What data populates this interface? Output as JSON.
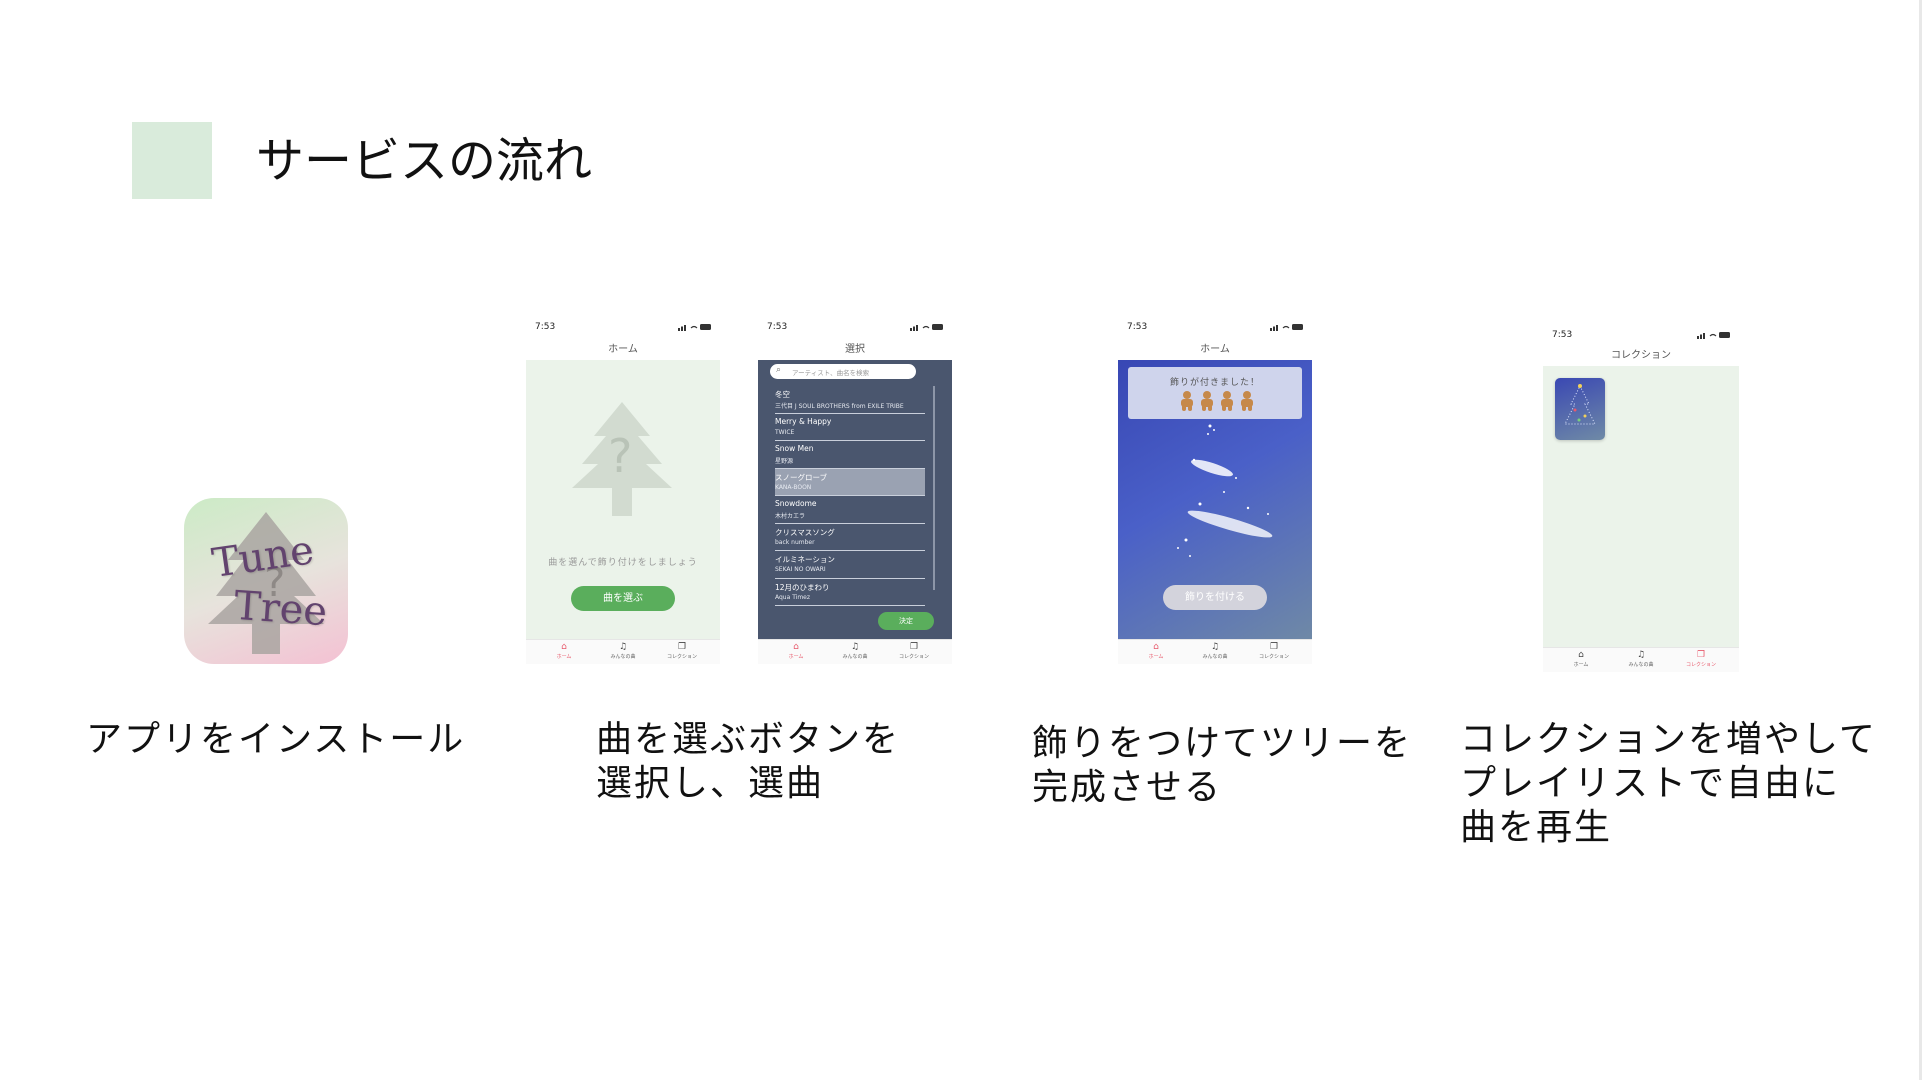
{
  "slide": {
    "title": "サービスの流れ",
    "accent_color": "#d9ebdb"
  },
  "steps": [
    {
      "caption": [
        "アプリをインストール"
      ]
    },
    {
      "caption": [
        "曲を選ぶボタンを",
        "選択し、選曲"
      ]
    },
    {
      "caption": [
        "飾りをつけてツリーを",
        "完成させる"
      ]
    },
    {
      "caption": [
        "コレクションを増やして",
        "プレイリストで自由に",
        "曲を再生"
      ]
    }
  ],
  "app_icon": {
    "line1": "Tune",
    "line2": "Tree",
    "tree_icon": "tree-icon"
  },
  "tabbar": {
    "home": "ホーム",
    "everyone": "みんなの曲",
    "collection": "コレクション"
  },
  "screen_home": {
    "time": "7:53",
    "nav_title": "ホーム",
    "prompt": "曲を選んで飾り付けをしましょう",
    "button": "曲を選ぶ",
    "background": "#ebf3ea",
    "button_color": "#5aae5c"
  },
  "screen_select": {
    "time": "7:53",
    "nav_title": "選択",
    "search_placeholder": "アーティスト、曲名を検索",
    "songs": [
      {
        "title": "冬空",
        "artist": "三代目 J SOUL BROTHERS from EXILE TRIBE",
        "selected": false
      },
      {
        "title": "Merry & Happy",
        "artist": "TWICE",
        "selected": false
      },
      {
        "title": "Snow Men",
        "artist": "星野源",
        "selected": false
      },
      {
        "title": "スノーグローブ",
        "artist": "KANA-BOON",
        "selected": true
      },
      {
        "title": "Snowdome",
        "artist": "木村カエラ",
        "selected": false
      },
      {
        "title": "クリスマスソング",
        "artist": "back number",
        "selected": false
      },
      {
        "title": "イルミネーション",
        "artist": "SEKAI NO OWARI",
        "selected": false
      },
      {
        "title": "12月のひまわり",
        "artist": "Aqua Timez",
        "selected": false
      }
    ],
    "confirm": "決定",
    "background": "#4a566e"
  },
  "screen_tree": {
    "time": "7:53",
    "nav_title": "ホーム",
    "banner": "飾りが付きました！",
    "ornament_count": 4,
    "button": "飾りを付ける"
  },
  "screen_collection": {
    "time": "7:53",
    "nav_title": "コレクション",
    "background": "#ebf3ea"
  }
}
